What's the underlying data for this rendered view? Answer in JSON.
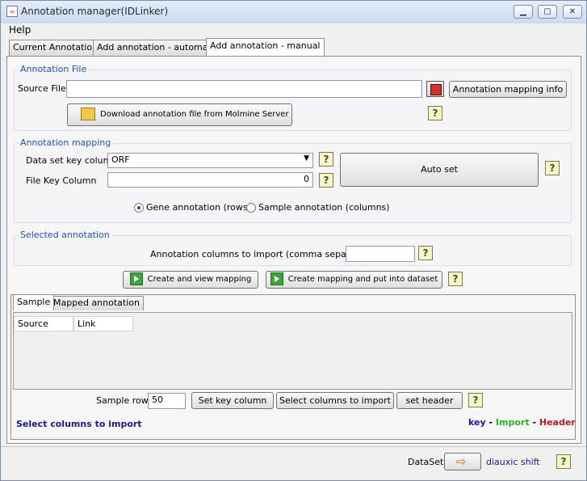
{
  "window": {
    "title": "Annotation manager(IDLinker)"
  },
  "menu": {
    "help": "Help"
  },
  "tabs": [
    "Current Annotation",
    "Add annotation - automatic",
    "Add annotation - manual"
  ],
  "annotation_file": {
    "title": "Annotation File",
    "source_label": "Source File",
    "source_value": "",
    "mapping_info_button": "Annotation mapping info",
    "download_button": "Download annotation file from Molmine Server"
  },
  "annotation_mapping": {
    "title": "Annotation mapping",
    "dataset_key_label": "Data set key column",
    "dataset_key_value": "ORF",
    "file_key_label": "File Key Column",
    "file_key_value": "0",
    "auto_set_button": "Auto set",
    "radio_gene": "Gene annotation (rows)",
    "radio_sample": "Sample annotation (columns)",
    "selected_radio": "gene"
  },
  "selected_annotation": {
    "title": "Selected annotation",
    "columns_label": "Annotation columns to import (comma separated)",
    "columns_value": ""
  },
  "actions": {
    "create_view": "Create and view mapping",
    "create_put": "Create mapping and put into dataset"
  },
  "lower_tabs": [
    "Sample",
    "Mapped annotation"
  ],
  "table": {
    "headers": [
      "Source",
      "Link"
    ],
    "rows": []
  },
  "sample_rows": {
    "label": "Sample rows",
    "value": "50",
    "set_key_button": "Set key column",
    "select_columns_button": "Select columns to import",
    "set_header_button": "set header"
  },
  "status": {
    "message": "Select columns to import"
  },
  "legend": {
    "key": "key",
    "import": "Import",
    "header": "Header",
    "sep": "-",
    "colors": {
      "key": "#1a1aa0",
      "import": "#2fb02f",
      "header": "#b02020"
    }
  },
  "footer": {
    "dataset_label": "DataSet",
    "dataset_name": "diauxic shift"
  },
  "help_glyph": "?"
}
